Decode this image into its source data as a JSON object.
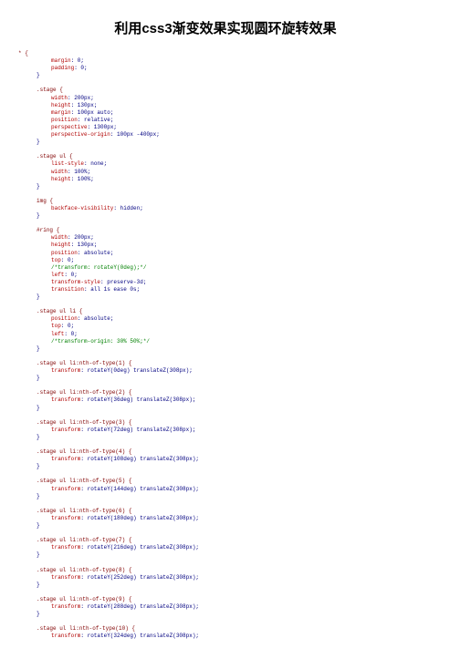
{
  "title": "利用css3渐变效果实现圆环旋转效果",
  "code": {
    "star_sel": "* {",
    "margin0": "margin: 0;",
    "padding0": "padding: 0;",
    "close": "}",
    "stage_sel": ".stage {",
    "stage_p1": "width: 200px;",
    "stage_p2": "height: 130px;",
    "stage_p3": "margin: 100px auto;",
    "stage_p4": "position: relative;",
    "stage_p5": "perspective: 1300px;",
    "stage_p6": "perspective-origin: 100px -400px;",
    "stageul_sel": ".stage ul {",
    "stageul_p1": "list-style: none;",
    "stageul_p2": "width: 100%;",
    "stageul_p3": "height: 100%;",
    "img_sel": "img {",
    "img_p1": "backface-visibility: hidden;",
    "ring_sel": "#ring {",
    "ring_p1": "width: 200px;",
    "ring_p2": "height: 130px;",
    "ring_p3": "position: absolute;",
    "ring_p4": "top: 0;",
    "ring_c1": "/*transform: rotateY(0deg);*/",
    "ring_p5": "left: 0;",
    "ring_p6": "transform-style: preserve-3d;",
    "ring_p7": "transition: all 1s ease 0s;",
    "li_sel": ".stage ul li {",
    "li_p1": "position: absolute;",
    "li_p2": "top: 0;",
    "li_p3": "left: 0;",
    "li_c1": "/*transform-origin: 30% 50%;*/",
    "n1_sel": ".stage ul li:nth-of-type(1) {",
    "n1_p": "transform: rotateY(0deg) translateZ(308px);",
    "n2_sel": ".stage ul li:nth-of-type(2) {",
    "n2_p": "transform: rotateY(36deg) translateZ(308px);",
    "n3_sel": ".stage ul li:nth-of-type(3) {",
    "n3_p": "transform: rotateY(72deg) translateZ(308px);",
    "n4_sel": ".stage ul li:nth-of-type(4) {",
    "n4_p": "transform: rotateY(108deg) translateZ(308px);",
    "n5_sel": ".stage ul li:nth-of-type(5) {",
    "n5_p": "transform: rotateY(144deg) translateZ(308px);",
    "n6_sel": ".stage ul li:nth-of-type(6) {",
    "n6_p": "transform: rotateY(180deg) translateZ(308px);",
    "n7_sel": ".stage ul li:nth-of-type(7) {",
    "n7_p": "transform: rotateY(216deg) translateZ(308px);",
    "n8_sel": ".stage ul li:nth-of-type(8) {",
    "n8_p": "transform: rotateY(252deg) translateZ(308px);",
    "n9_sel": ".stage ul li:nth-of-type(9) {",
    "n9_p": "transform: rotateY(288deg) translateZ(308px);",
    "n10_sel": ".stage ul li:nth-of-type(10) {",
    "n10_p": "transform: rotateY(324deg) translateZ(308px);"
  }
}
